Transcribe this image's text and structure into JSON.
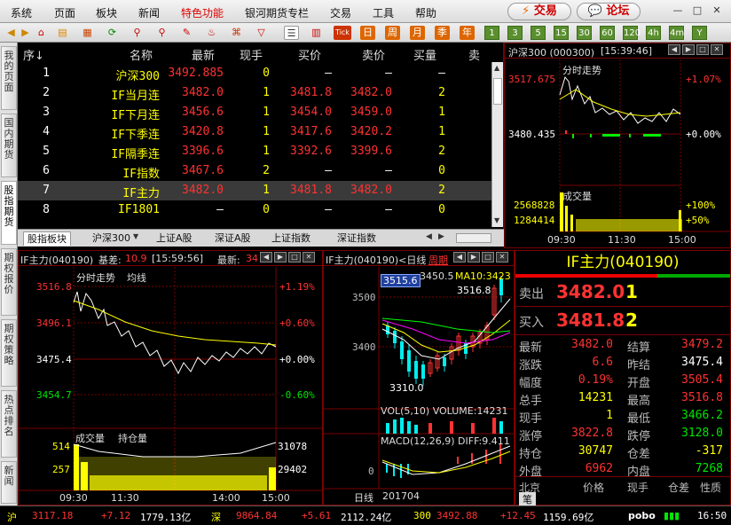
{
  "menu": [
    "系统",
    "页面",
    "板块",
    "新闻",
    "特色功能",
    "银河期货专栏",
    "交易",
    "工具",
    "帮助"
  ],
  "trade_btn": "交易",
  "forum_btn": "论坛",
  "toolbar_labels": {
    "tick": "Tick",
    "day": "日",
    "week": "周",
    "month": "月",
    "season": "季",
    "year": "年",
    "n1": "1",
    "n3": "3",
    "n5": "5",
    "n15": "15",
    "n30": "30",
    "n60": "60",
    "h4": "4h",
    "y": "Y"
  },
  "left_tabs": [
    "我的页面",
    "国内期货",
    "股指期货",
    "期权报价",
    "期权策略",
    "热点排名",
    "新闻"
  ],
  "quote_table": {
    "headers": [
      "序↓",
      "名称",
      "最新",
      "现手",
      "买价",
      "卖价",
      "买量",
      "卖"
    ],
    "rows": [
      {
        "idx": "1",
        "name": "沪深300",
        "last": "3492.885",
        "vol": "0",
        "bid": "—",
        "ask": "—",
        "bidv": "—"
      },
      {
        "idx": "2",
        "name": "IF当月连",
        "last": "3482.0",
        "vol": "1",
        "bid": "3481.8",
        "ask": "3482.0",
        "bidv": "2"
      },
      {
        "idx": "3",
        "name": "IF下月连",
        "last": "3456.6",
        "vol": "1",
        "bid": "3454.0",
        "ask": "3459.0",
        "bidv": "1"
      },
      {
        "idx": "4",
        "name": "IF下季连",
        "last": "3420.8",
        "vol": "1",
        "bid": "3417.6",
        "ask": "3420.2",
        "bidv": "1"
      },
      {
        "idx": "5",
        "name": "IF隔季连",
        "last": "3396.6",
        "vol": "1",
        "bid": "3392.6",
        "ask": "3399.6",
        "bidv": "2"
      },
      {
        "idx": "6",
        "name": "IF指数",
        "last": "3467.6",
        "vol": "2",
        "bid": "—",
        "ask": "—",
        "bidv": "0"
      },
      {
        "idx": "7",
        "name": "IF主力",
        "last": "3482.0",
        "vol": "1",
        "bid": "3481.8",
        "ask": "3482.0",
        "bidv": "2"
      },
      {
        "idx": "8",
        "name": "IF1801",
        "last": "—",
        "vol": "0",
        "bid": "—",
        "ask": "—",
        "bidv": "0"
      }
    ],
    "tabs": [
      "股指板块",
      "沪深300",
      "上证A股",
      "深证A股",
      "上证指数",
      "深证指数"
    ]
  },
  "hs300_panel": {
    "title": "沪深300 (000300)",
    "time": "[15:39:46]",
    "chart_label": "分时走势",
    "price_top": "3517.675",
    "pct_top": "+1.07%",
    "price_mid": "3480.435",
    "pct_mid": "+0.00%",
    "vol_label": "成交量",
    "vol_top": "2568828",
    "vol_top_pct": "+100%",
    "vol_mid": "1284414",
    "vol_mid_pct": "+50%",
    "times": [
      "09:30",
      "11:30",
      "15:00"
    ]
  },
  "if_intraday": {
    "title_code": "IF主力(040190)",
    "basis_label": "基差:",
    "basis_value": "10.9",
    "time": "[15:59:56]",
    "last_label": "最新:",
    "last_value": "34",
    "chart_label": "分时走势",
    "avg_label": "均线",
    "prices": [
      "3516.8",
      "3496.1",
      "3475.4",
      "3454.7"
    ],
    "pcts": [
      "+1.19%",
      "+0.60%",
      "+0.00%",
      "-0.60%"
    ],
    "vol_label": "成交量",
    "oi_label": "持仓量",
    "vols": [
      "514",
      "257"
    ],
    "ois": [
      "31078",
      "29402"
    ],
    "times": [
      "09:30",
      "11:30",
      "14:00",
      "15:00"
    ]
  },
  "if_daily": {
    "title": "IF主力(040190)<日线",
    "period": "周期",
    "cursor_price": "3515.6",
    "ma5": "3450.5",
    "ma10": "MA10:3423",
    "high_label": "3516.8",
    "low_label": "3310.0",
    "y_labels": [
      "3500",
      "3400"
    ],
    "vol_label": "VOL(5,10) VOLUME:14231",
    "macd_label": "MACD(12,26,9) DIFF:9.411",
    "macd_zero": "0",
    "period_label": "日线",
    "date": "201704"
  },
  "detail": {
    "title": "IF主力(040190)",
    "sell_label": "卖出",
    "sell_price": "3482.0",
    "sell_vol": "1",
    "buy_label": "买入",
    "buy_price": "3481.8",
    "buy_vol": "2",
    "rows": [
      {
        "l1": "最新",
        "v1": "3482.0",
        "l2": "结算",
        "v2": "3479.2"
      },
      {
        "l1": "涨跌",
        "v1": "6.6",
        "l2": "昨结",
        "v2": "3475.4"
      },
      {
        "l1": "幅度",
        "v1": "0.19%",
        "l2": "开盘",
        "v2": "3505.4"
      },
      {
        "l1": "总手",
        "v1": "14231",
        "l2": "最高",
        "v2": "3516.8"
      },
      {
        "l1": "现手",
        "v1": "1",
        "l2": "最低",
        "v2": "3466.2"
      },
      {
        "l1": "涨停",
        "v1": "3822.8",
        "l2": "跌停",
        "v2": "3128.0"
      },
      {
        "l1": "持仓",
        "v1": "30747",
        "l2": "仓差",
        "v2": "-317"
      },
      {
        "l1": "外盘",
        "v1": "6962",
        "l2": "内盘",
        "v2": "7268"
      }
    ],
    "tick_headers": [
      "北京",
      "价格",
      "现手",
      "仓差",
      "性质"
    ],
    "tick_tab": "笔"
  },
  "status": {
    "sh_label": "沪",
    "sh_value": "3117.18",
    "sh_chg": "+7.12",
    "sh_amt": "1779.13亿",
    "sz_label": "深",
    "sz_value": "9864.84",
    "sz_chg": "+5.61",
    "sz_amt": "2112.24亿",
    "hs_label": "300",
    "hs_value": "3492.88",
    "hs_chg": "+12.45",
    "hs_amt": "1159.69亿",
    "brand": "pobo",
    "time": "16:50"
  }
}
